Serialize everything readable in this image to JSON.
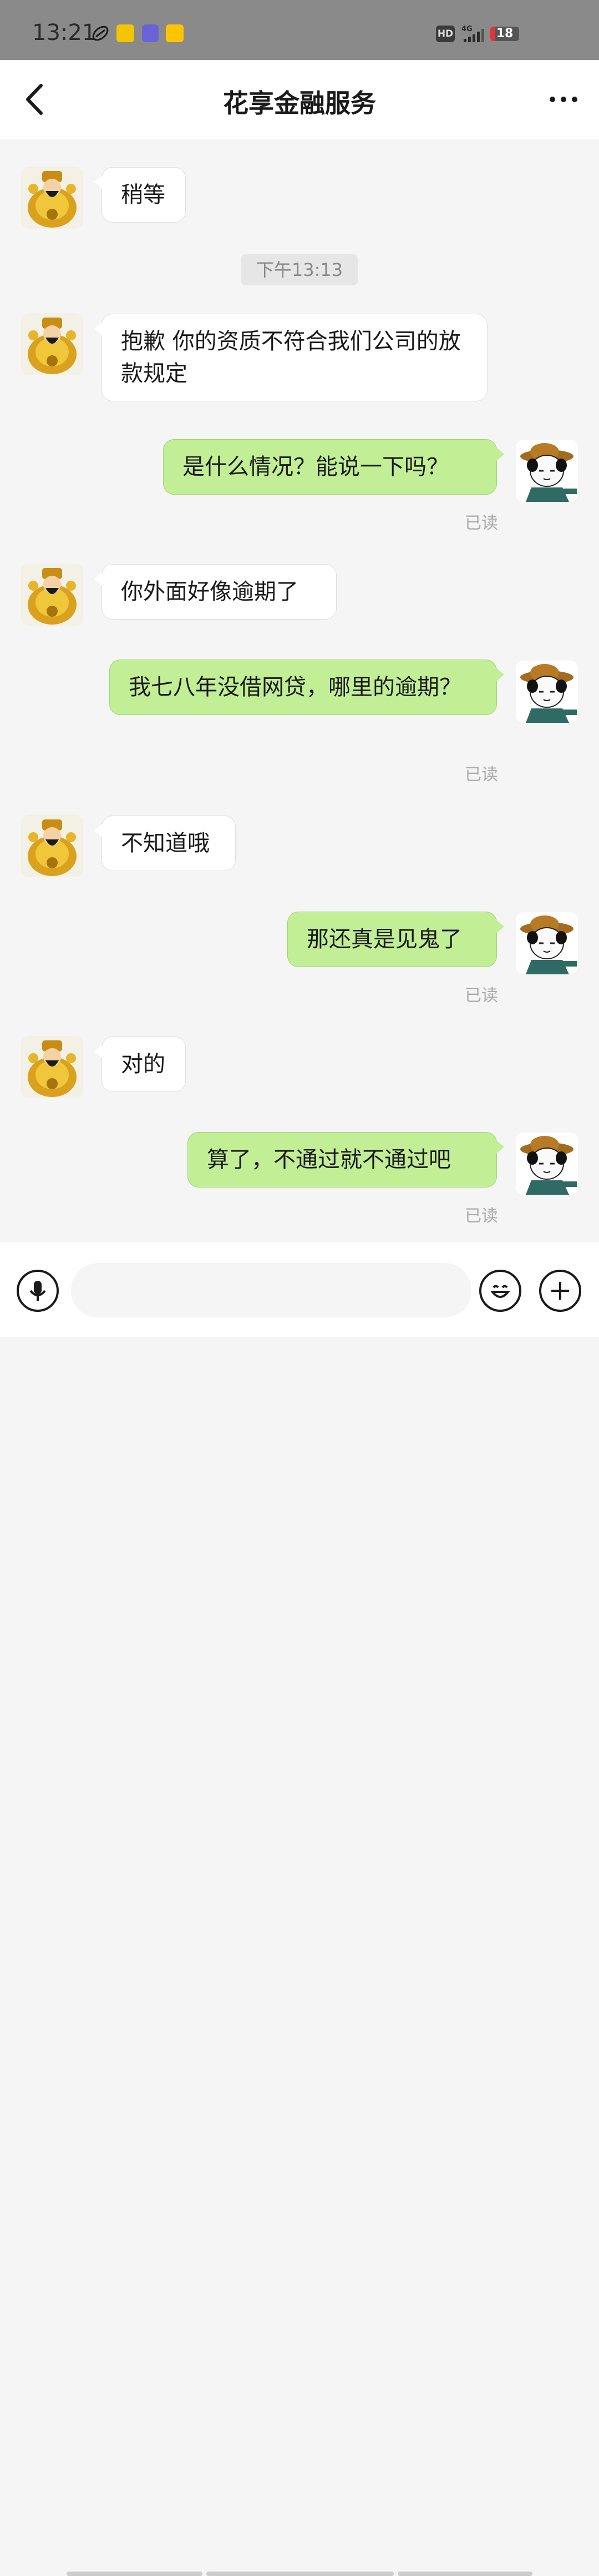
{
  "status_bar": {
    "time": "13:21",
    "hd_label": "HD",
    "network_label": "4G",
    "battery_level": "18",
    "battery_fraction": 0.18,
    "app_icons": [
      "rocket-icon",
      "game-app-icon",
      "tie-app-icon",
      "meituan-app-icon"
    ]
  },
  "header": {
    "title": "花享金融服务",
    "back_icon": "chevron-left-icon",
    "more_icon": "more-dots-icon"
  },
  "chat": {
    "timestamp": "下午13:13",
    "read_label": "已读",
    "messages": [
      {
        "side": "in",
        "text": "稍等"
      },
      {
        "side": "in",
        "text": "抱歉 你的资质不符合我们公司的放款规定"
      },
      {
        "side": "out",
        "text": "是什么情况？能说一下吗？",
        "read": "已读"
      },
      {
        "side": "in",
        "text": "你外面好像逾期了"
      },
      {
        "side": "out",
        "text": "我七八年没借网贷，哪里的逾期？",
        "read": "已读"
      },
      {
        "side": "in",
        "text": "不知道哦"
      },
      {
        "side": "out",
        "text": "那还真是见鬼了",
        "read": "已读"
      },
      {
        "side": "in",
        "text": "对的"
      },
      {
        "side": "out",
        "text": "算了，不通过就不通过吧",
        "read": "已读"
      }
    ]
  },
  "input_bar": {
    "voice_icon": "microphone-icon",
    "emoji_icon": "emoji-icon",
    "plus_icon": "plus-icon",
    "placeholder": ""
  },
  "colors": {
    "status_bar_bg": "#8a8a8a",
    "outgoing_bubble": "#c2ef96",
    "incoming_bubble": "#ffffff",
    "chat_bg": "#f5f5f5",
    "read_text": "#aaaaaa"
  }
}
